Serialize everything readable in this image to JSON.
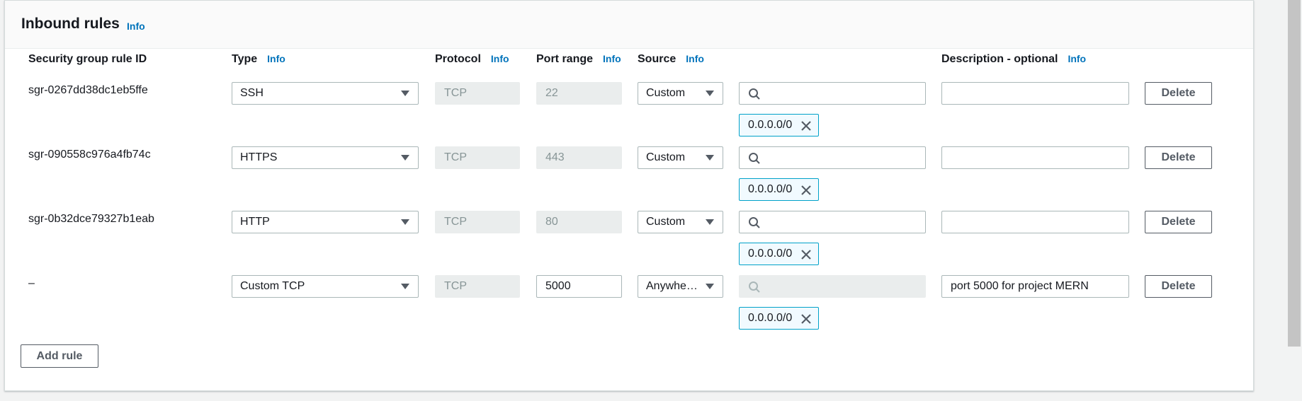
{
  "section": {
    "title": "Inbound rules",
    "info": "Info"
  },
  "columns": {
    "rule_id": "Security group rule ID",
    "type": "Type",
    "type_info": "Info",
    "protocol": "Protocol",
    "protocol_info": "Info",
    "port_range": "Port range",
    "port_range_info": "Info",
    "source": "Source",
    "source_info": "Info",
    "description": "Description - optional",
    "description_info": "Info"
  },
  "rules": [
    {
      "id": "sgr-0267dd38dc1eb5ffe",
      "type": "SSH",
      "protocol": "TCP",
      "port": "22",
      "source": "Custom",
      "cidr": "0.0.0.0/0",
      "description": "",
      "delete": "Delete"
    },
    {
      "id": "sgr-090558c976a4fb74c",
      "type": "HTTPS",
      "protocol": "TCP",
      "port": "443",
      "source": "Custom",
      "cidr": "0.0.0.0/0",
      "description": "",
      "delete": "Delete"
    },
    {
      "id": "sgr-0b32dce79327b1eab",
      "type": "HTTP",
      "protocol": "TCP",
      "port": "80",
      "source": "Custom",
      "cidr": "0.0.0.0/0",
      "description": "",
      "delete": "Delete"
    },
    {
      "id": "–",
      "type": "Custom TCP",
      "protocol": "TCP",
      "port": "5000",
      "source": "Anywhe…",
      "cidr": "0.0.0.0/0",
      "description": "port 5000 for project MERN",
      "delete": "Delete"
    }
  ],
  "add_rule": "Add rule",
  "icons": {
    "search": "search-icon",
    "remove": "close-icon",
    "dropdown": "caret-down-icon"
  },
  "colors": {
    "info_link": "#0073bb",
    "token_border": "#00a1c9",
    "token_bg": "#f1faff",
    "disabled_bg": "#eaeded"
  }
}
